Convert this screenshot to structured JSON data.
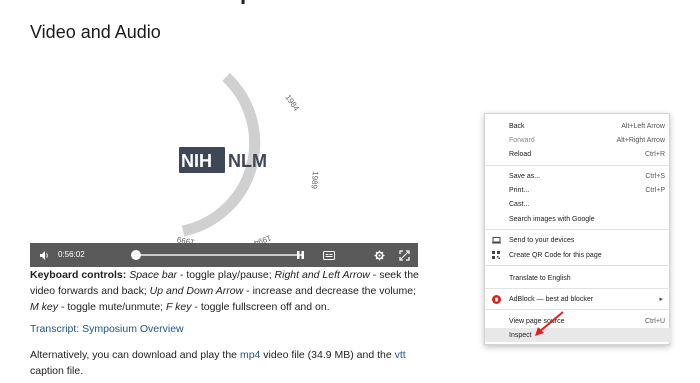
{
  "page": {
    "title": "Video and Audio",
    "top_fragment": "p"
  },
  "video": {
    "logo_left": "NIH",
    "logo_right": "NLM",
    "arc_labels": [
      "1984",
      "1989",
      "1994",
      "1999"
    ],
    "time": "0:56:02",
    "progress": 0.0
  },
  "text": {
    "kb_label": "Keyboard controls:",
    "kb_space": "Space bar",
    "kb_space_desc": " - toggle play/pause; ",
    "kb_lr": "Right and Left Arrow",
    "kb_lr_desc": " - seek the video forwards and back; ",
    "kb_ud": "Up and Down Arrow",
    "kb_ud_desc": " - increase and decrease the volume; ",
    "kb_m": "M key",
    "kb_m_desc": " - toggle mute/unmute; ",
    "kb_f": "F key",
    "kb_f_desc": " - toggle fullscreen off and on.",
    "transcript": "Transcript: Symposium Overview",
    "alt_1": "Alternatively, you can download and play the ",
    "alt_mp4": "mp4",
    "alt_2": " video file (34.9 MB) and the ",
    "alt_vtt": "vtt",
    "alt_3": "caption file."
  },
  "context_menu": {
    "back": {
      "label": "Back",
      "shortcut": "Alt+Left Arrow"
    },
    "forward": {
      "label": "Forward",
      "shortcut": "Alt+Right Arrow"
    },
    "reload": {
      "label": "Reload",
      "shortcut": "Ctrl+R"
    },
    "save_as": {
      "label": "Save as...",
      "shortcut": "Ctrl+S"
    },
    "print": {
      "label": "Print...",
      "shortcut": "Ctrl+P"
    },
    "cast": {
      "label": "Cast..."
    },
    "search_images": {
      "label": "Search images with Google"
    },
    "send_devices": {
      "label": "Send to your devices"
    },
    "qr_code": {
      "label": "Create QR Code for this page"
    },
    "translate": {
      "label": "Translate to English"
    },
    "adblock": {
      "label": "AdBlock — best ad blocker"
    },
    "view_source": {
      "label": "View page source",
      "shortcut": "Ctrl+U"
    },
    "inspect": {
      "label": "Inspect"
    }
  },
  "colors": {
    "control_bar": "#5a5a5a",
    "link": "#20558a",
    "annotation_arrow": "#e0201c",
    "logo_box": "#3d4756",
    "adblock_red": "#e0201c"
  }
}
